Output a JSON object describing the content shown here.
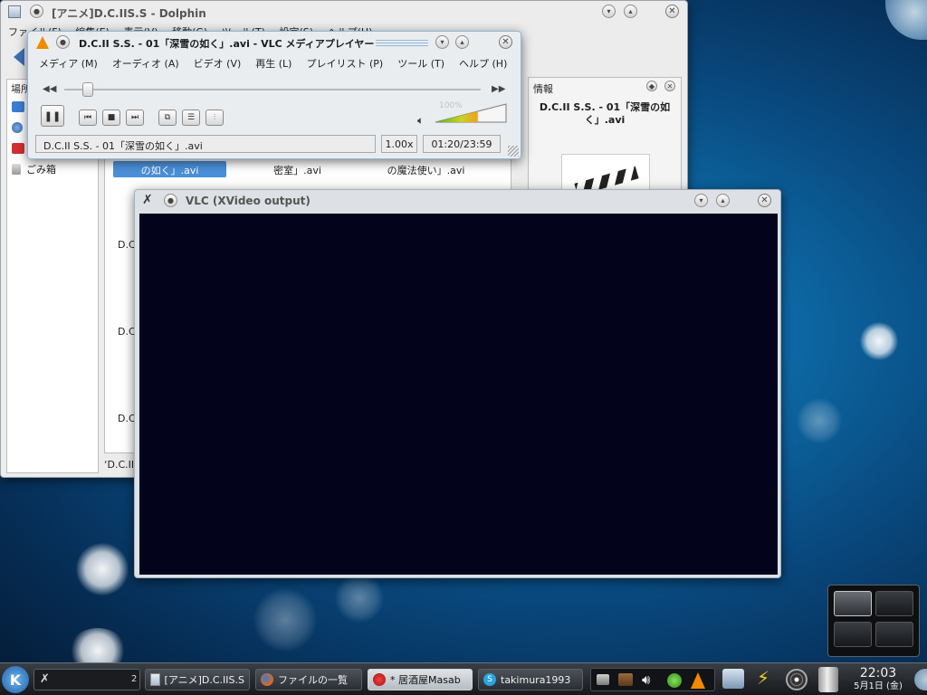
{
  "dolphin": {
    "title": "[アニメ]D.C.IIS.S - Dolphin",
    "menu": [
      "ファイル(F)",
      "編集(E)",
      "表示(V)",
      "移動(G)",
      "ツール(T)",
      "設定(S)",
      "ヘルプ(H)"
    ],
    "places_title": "場所",
    "places": [
      "",
      "",
      "",
      "ごみ箱"
    ],
    "files_top": [
      "の如く」.avi",
      "密室」.avi",
      "の魔法使い」.avi"
    ],
    "row_labels": [
      "D.C",
      "D.C",
      "D.C"
    ],
    "status_prefix": "‘D.C.II",
    "info_title": "情報",
    "info_filename": "D.C.II S.S. - 01「深雪の如く」.avi"
  },
  "vlc_main": {
    "title": "D.C.II S.S. - 01「深雪の如く」.avi - VLC メディアプレイヤー",
    "menu": [
      "メディア (M)",
      "オーディオ (A)",
      "ビデオ (V)",
      "再生 (L)",
      "プレイリスト (P)",
      "ツール (T)",
      "ヘルプ (H)"
    ],
    "now_playing": "D.C.II S.S. - 01「深雪の如く」.avi",
    "speed": "1.00x",
    "time": "01:20/23:59",
    "volume_label": "100%",
    "position_fraction": 0.056,
    "volume_fraction": 0.6
  },
  "vlc_video": {
    "title": "VLC (XVideo output)"
  },
  "taskbar": {
    "desktop_switch": "2",
    "tasks": [
      {
        "label": "[アニメ]D.C.IIS.S",
        "active": false
      },
      {
        "label": "ファイルの一覧",
        "active": false
      },
      {
        "label": "* 居酒屋Masab",
        "active": true
      },
      {
        "label": "takimura1993",
        "active": false
      }
    ],
    "clock_time": "22:03",
    "clock_date": "5月1日 (金)"
  }
}
